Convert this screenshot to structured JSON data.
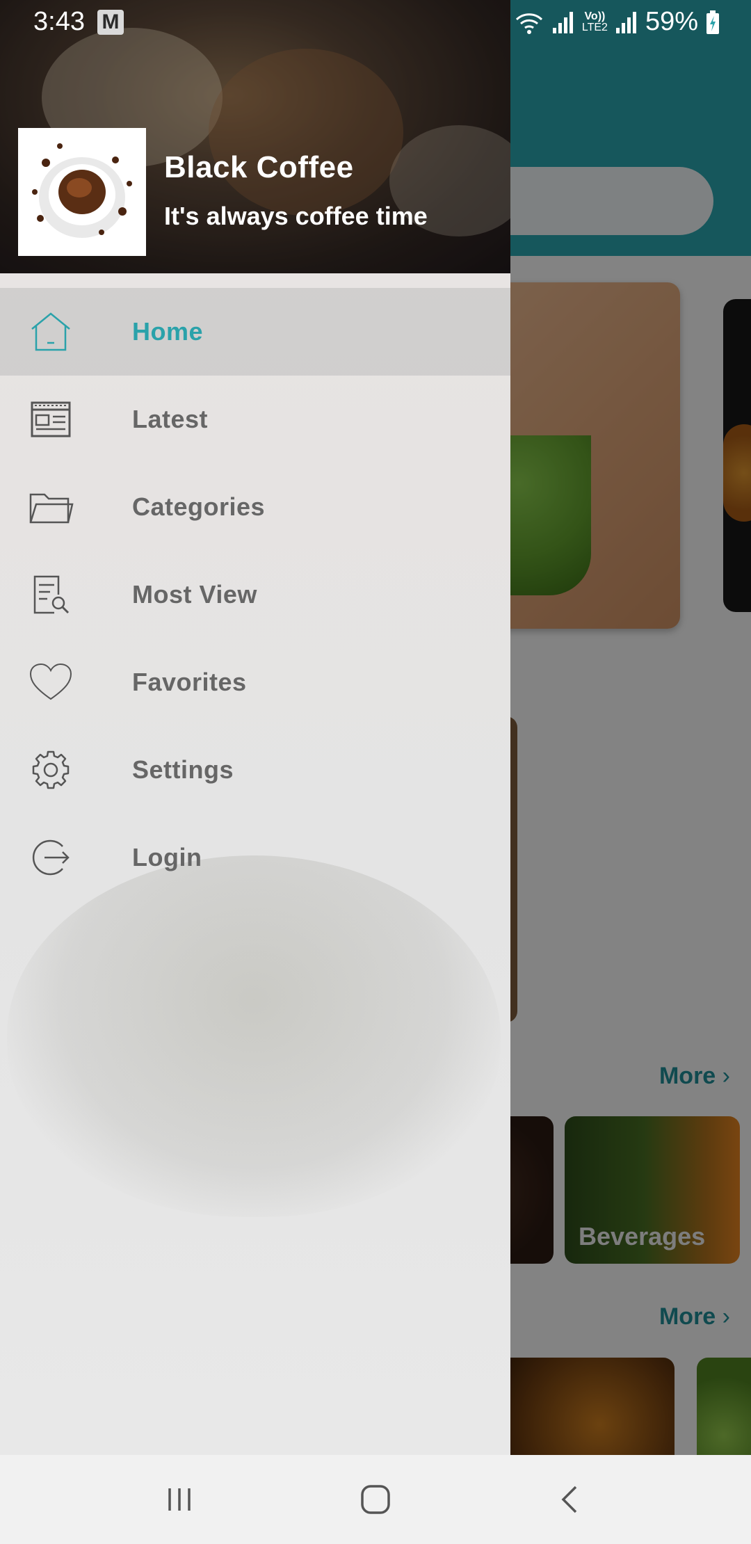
{
  "status_bar": {
    "time": "3:43",
    "notification_icon": "M",
    "network_label_top": "Vo))",
    "network_label_bottom": "LTE2",
    "battery": "59%"
  },
  "drawer": {
    "app_name": "Black Coffee",
    "tagline": "It's always coffee time",
    "menu": [
      {
        "label": "Home",
        "icon": "home-icon",
        "active": true
      },
      {
        "label": "Latest",
        "icon": "newspaper-icon",
        "active": false
      },
      {
        "label": "Categories",
        "icon": "folder-icon",
        "active": false
      },
      {
        "label": "Most View",
        "icon": "document-search-icon",
        "active": false
      },
      {
        "label": "Favorites",
        "icon": "heart-icon",
        "active": false
      },
      {
        "label": "Settings",
        "icon": "gear-icon",
        "active": false
      },
      {
        "label": "Login",
        "icon": "logout-icon",
        "active": false
      }
    ]
  },
  "background": {
    "more_label_1": "More",
    "more_label_2": "More",
    "category_tile": "Beverages"
  },
  "colors": {
    "accent": "#2aa2aa",
    "menu_text": "#666666",
    "header_teal": "#2aa2aa"
  }
}
